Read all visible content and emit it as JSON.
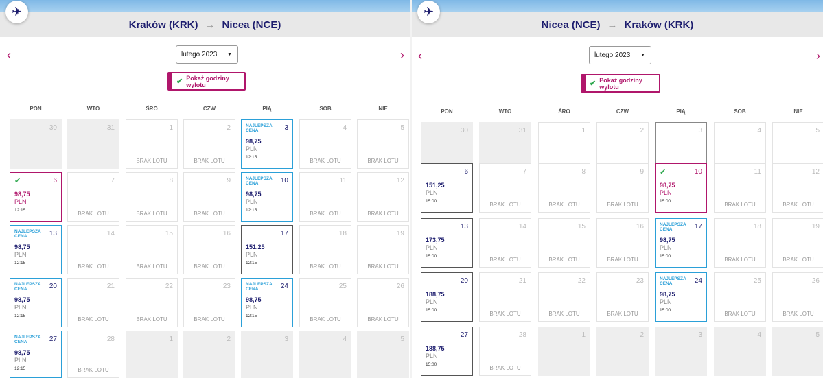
{
  "left": {
    "origin": "Kraków (KRK)",
    "arrow": "→",
    "destination": "Nicea (NCE)",
    "month": "lutego 2023",
    "toggle_label": "Pokaż godziny wylotu",
    "days": [
      "PON",
      "WTO",
      "ŚRO",
      "CZW",
      "PIĄ",
      "SOB",
      "NIE"
    ],
    "weeks": [
      [
        {
          "d": "30",
          "t": "empty"
        },
        {
          "d": "31",
          "t": "empty"
        },
        {
          "d": "1",
          "t": "none",
          "n": "BRAK LOTU"
        },
        {
          "d": "2",
          "t": "none",
          "n": "BRAK LOTU"
        },
        {
          "d": "3",
          "t": "best",
          "b": "NAJLEPSZA CENA",
          "p": "98,75",
          "c": "PLN",
          "h": "12:15"
        },
        {
          "d": "4",
          "t": "none",
          "n": "BRAK LOTU"
        },
        {
          "d": "5",
          "t": "none",
          "n": "BRAK LOTU"
        }
      ],
      [
        {
          "d": "6",
          "t": "sel",
          "p": "98,75",
          "c": "PLN",
          "h": "12:15"
        },
        {
          "d": "7",
          "t": "none",
          "n": "BRAK LOTU"
        },
        {
          "d": "8",
          "t": "none",
          "n": "BRAK LOTU"
        },
        {
          "d": "9",
          "t": "none",
          "n": "BRAK LOTU"
        },
        {
          "d": "10",
          "t": "best",
          "b": "NAJLEPSZA CENA",
          "p": "98,75",
          "c": "PLN",
          "h": "12:15"
        },
        {
          "d": "11",
          "t": "none",
          "n": "BRAK LOTU"
        },
        {
          "d": "12",
          "t": "none",
          "n": "BRAK LOTU"
        }
      ],
      [
        {
          "d": "13",
          "t": "best",
          "b": "NAJLEPSZA CENA",
          "p": "98,75",
          "c": "PLN",
          "h": "12:15"
        },
        {
          "d": "14",
          "t": "none",
          "n": "BRAK LOTU"
        },
        {
          "d": "15",
          "t": "none",
          "n": "BRAK LOTU"
        },
        {
          "d": "16",
          "t": "none",
          "n": "BRAK LOTU"
        },
        {
          "d": "17",
          "t": "norm",
          "p": "151,25",
          "c": "PLN",
          "h": "12:15"
        },
        {
          "d": "18",
          "t": "none",
          "n": "BRAK LOTU"
        },
        {
          "d": "19",
          "t": "none",
          "n": "BRAK LOTU"
        }
      ],
      [
        {
          "d": "20",
          "t": "best",
          "b": "NAJLEPSZA CENA",
          "p": "98,75",
          "c": "PLN",
          "h": "12:15"
        },
        {
          "d": "21",
          "t": "none",
          "n": "BRAK LOTU"
        },
        {
          "d": "22",
          "t": "none",
          "n": "BRAK LOTU"
        },
        {
          "d": "23",
          "t": "none",
          "n": "BRAK LOTU"
        },
        {
          "d": "24",
          "t": "best",
          "b": "NAJLEPSZA CENA",
          "p": "98,75",
          "c": "PLN",
          "h": "12:15"
        },
        {
          "d": "25",
          "t": "none",
          "n": "BRAK LOTU"
        },
        {
          "d": "26",
          "t": "none",
          "n": "BRAK LOTU"
        }
      ],
      [
        {
          "d": "27",
          "t": "best",
          "b": "NAJLEPSZA CENA",
          "p": "98,75",
          "c": "PLN",
          "h": "12:15"
        },
        {
          "d": "28",
          "t": "none",
          "n": "BRAK LOTU"
        },
        {
          "d": "1",
          "t": "empty"
        },
        {
          "d": "2",
          "t": "empty"
        },
        {
          "d": "3",
          "t": "empty"
        },
        {
          "d": "4",
          "t": "empty"
        },
        {
          "d": "5",
          "t": "empty"
        }
      ]
    ]
  },
  "right": {
    "origin": "Nicea (NCE)",
    "arrow": "→",
    "destination": "Kraków (KRK)",
    "month": "lutego 2023",
    "toggle_label": "Pokaż godziny wylotu",
    "days": [
      "PON",
      "WTO",
      "ŚRO",
      "CZW",
      "PIĄ",
      "SOB",
      "NIE"
    ],
    "weeks": [
      [
        {
          "d": "30",
          "t": "empty"
        },
        {
          "d": "31",
          "t": "empty"
        },
        {
          "d": "1",
          "t": "plain"
        },
        {
          "d": "2",
          "t": "plain"
        },
        {
          "d": "3",
          "t": "outline"
        },
        {
          "d": "4",
          "t": "plain"
        },
        {
          "d": "5",
          "t": "plain"
        }
      ],
      [
        {
          "d": "6",
          "t": "norm",
          "p": "151,25",
          "c": "PLN",
          "h": "15:00"
        },
        {
          "d": "7",
          "t": "none",
          "n": "BRAK LOTU"
        },
        {
          "d": "8",
          "t": "none",
          "n": "BRAK LOTU"
        },
        {
          "d": "9",
          "t": "none",
          "n": "BRAK LOTU"
        },
        {
          "d": "10",
          "t": "sel",
          "p": "98,75",
          "c": "PLN",
          "h": "15:00"
        },
        {
          "d": "11",
          "t": "none",
          "n": "BRAK LOTU"
        },
        {
          "d": "12",
          "t": "none",
          "n": "BRAK LOTU"
        }
      ],
      [
        {
          "d": "13",
          "t": "norm",
          "p": "173,75",
          "c": "PLN",
          "h": "15:00"
        },
        {
          "d": "14",
          "t": "none",
          "n": "BRAK LOTU"
        },
        {
          "d": "15",
          "t": "none",
          "n": "BRAK LOTU"
        },
        {
          "d": "16",
          "t": "none",
          "n": "BRAK LOTU"
        },
        {
          "d": "17",
          "t": "best",
          "b": "NAJLEPSZA CENA",
          "p": "98,75",
          "c": "PLN",
          "h": "15:00"
        },
        {
          "d": "18",
          "t": "none",
          "n": "BRAK LOTU"
        },
        {
          "d": "19",
          "t": "none",
          "n": "BRAK LOTU"
        }
      ],
      [
        {
          "d": "20",
          "t": "norm",
          "p": "188,75",
          "c": "PLN",
          "h": "15:00"
        },
        {
          "d": "21",
          "t": "none",
          "n": "BRAK LOTU"
        },
        {
          "d": "22",
          "t": "none",
          "n": "BRAK LOTU"
        },
        {
          "d": "23",
          "t": "none",
          "n": "BRAK LOTU"
        },
        {
          "d": "24",
          "t": "best",
          "b": "NAJLEPSZA CENA",
          "p": "98,75",
          "c": "PLN",
          "h": "15:00"
        },
        {
          "d": "25",
          "t": "none",
          "n": "BRAK LOTU"
        },
        {
          "d": "26",
          "t": "none",
          "n": "BRAK LOTU"
        }
      ],
      [
        {
          "d": "27",
          "t": "norm",
          "p": "188,75",
          "c": "PLN",
          "h": "15:00"
        },
        {
          "d": "28",
          "t": "none",
          "n": "BRAK LOTU"
        },
        {
          "d": "1",
          "t": "empty"
        },
        {
          "d": "2",
          "t": "empty"
        },
        {
          "d": "3",
          "t": "empty"
        },
        {
          "d": "4",
          "t": "empty"
        },
        {
          "d": "5",
          "t": "empty"
        }
      ]
    ]
  },
  "colors": {
    "brand": "#b0166b",
    "navy": "#1d1d6e",
    "best": "#2ba0d8",
    "check": "#2fa84f"
  },
  "icons": {
    "logo": "airplane-icon",
    "prev": "chevron-left-icon",
    "next": "chevron-right-icon",
    "caret": "caret-down-icon",
    "check": "checkmark-icon"
  }
}
